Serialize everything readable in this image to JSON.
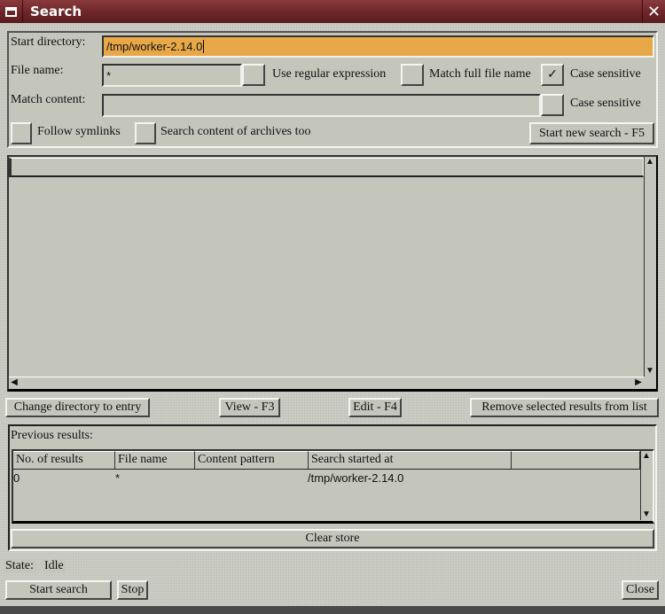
{
  "window": {
    "title": "Search"
  },
  "form": {
    "start_directory_label": "Start directory:",
    "start_directory_value": "/tmp/worker-2.14.0",
    "file_name_label": "File name:",
    "file_name_value": "*",
    "use_regex_label": "Use regular expression",
    "use_regex_checked": false,
    "match_full_label": "Match full file name",
    "match_full_checked": false,
    "case_sensitive_label": "Case sensitive",
    "case_sensitive_name_checked": true,
    "match_content_label": "Match content:",
    "match_content_value": "",
    "case_sensitive_content_label": "Case sensitive",
    "case_sensitive_content_checked": false,
    "follow_symlinks_label": "Follow symlinks",
    "search_archives_label": "Search content of archives too",
    "start_new_search_button": "Start new search - F5",
    "check_mark": "✓"
  },
  "actions": {
    "change_dir": "Change directory to entry",
    "view": "View - F3",
    "edit": "Edit - F4",
    "remove": "Remove selected results from list"
  },
  "previous": {
    "label": "Previous results:",
    "columns": [
      "No. of results",
      "File name",
      "Content pattern",
      "Search started at",
      ""
    ],
    "rows": [
      {
        "count": "0",
        "file_name": "*",
        "content_pattern": "",
        "started_at": "/tmp/worker-2.14.0"
      }
    ],
    "clear_button": "Clear store"
  },
  "status": {
    "label": "State:",
    "value": "Idle"
  },
  "footer": {
    "start_search": "Start search",
    "stop": "Stop",
    "close": "Close"
  },
  "colors": {
    "accent_input": "#e8a848",
    "titlebar": "#6a2426"
  }
}
